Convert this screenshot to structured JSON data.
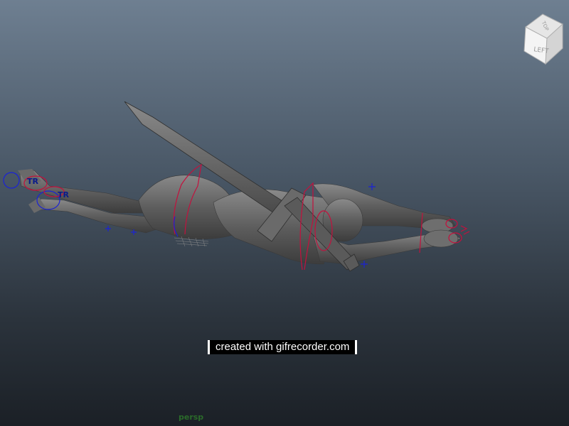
{
  "viewport": {
    "camera_name": "persp",
    "watermark_text": "created with gifrecorder.com",
    "view_cube": {
      "left_face": "LEFT",
      "top_face": "TOP"
    },
    "controls": {
      "left_foot_label": "TR",
      "right_foot_label": "TR"
    },
    "colors": {
      "bg_top": "#6e7f91",
      "bg_bottom": "#1b2026",
      "mesh": "#5e5e5e",
      "control_red": "#c4103d",
      "control_blue": "#1a22d6",
      "camera_label": "#2a6a2a"
    }
  }
}
